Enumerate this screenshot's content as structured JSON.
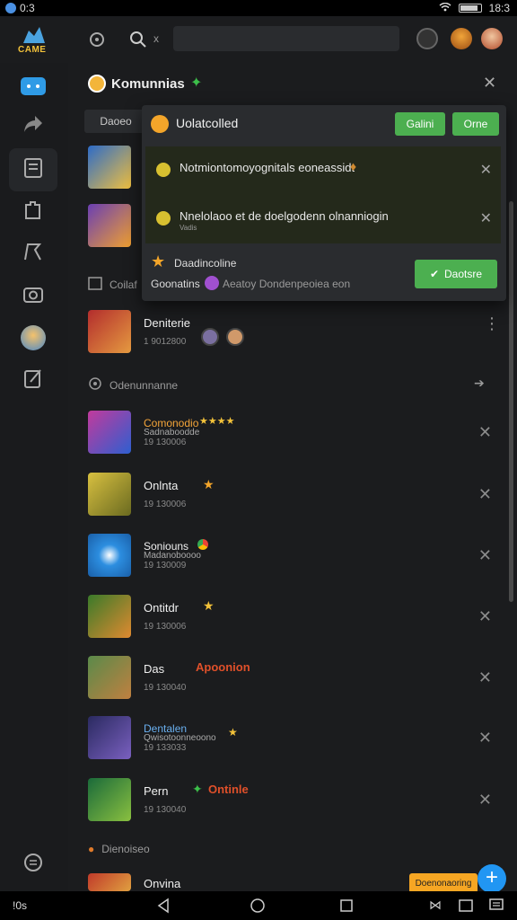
{
  "status": {
    "left_text": "0:3",
    "time": "18:3"
  },
  "topbar": {
    "logo_text": "CAME",
    "search_prefix": "x"
  },
  "panel": {
    "title": "Komunnias",
    "filter_tab": "Daoeo"
  },
  "popup": {
    "title": "Uolatcolled",
    "buttons": [
      "Galini",
      "Orne"
    ],
    "notifications": [
      {
        "text": "Notmiontomoyognitals eoneassidt",
        "sub": ""
      },
      {
        "text": "Nnelolaoo et de doelgodenn  olnanniogin",
        "sub": "Vadis"
      }
    ],
    "footer_title": "Daadincoline",
    "footer_text": "Goonatins",
    "footer_desc": "Aeatoy Dondenpeoiea eon",
    "action_button": "Daotsre"
  },
  "top_rows": [
    {
      "title": "Deniterie",
      "time": "1 9012800"
    }
  ],
  "section1": "Coilaf",
  "section2": "Odenunnanne",
  "list": [
    {
      "title": "Comonodio",
      "sub": "Sadnaboodde",
      "time": "19 130006",
      "stars": "★★★★"
    },
    {
      "title": "Onlnta",
      "sub": "",
      "time": "19 130006",
      "stars": "★"
    },
    {
      "title": "Soniouns",
      "sub": "Madanoboooo",
      "time": "19 130009",
      "stars": ""
    },
    {
      "title": "Ontitdr",
      "sub": "",
      "time": "19 130006",
      "stars": "★"
    },
    {
      "title": "Das",
      "sub": "",
      "time": "19 130040",
      "extra": "Apoonion"
    },
    {
      "title": "Dentalen",
      "sub": "Qwisotoonneoono",
      "time": "19 133033",
      "stars": "★"
    },
    {
      "title": "Pern",
      "sub": "",
      "time": "19 130040",
      "extra": "Ontinle"
    }
  ],
  "section3": "Dienoiseo",
  "bottom_row": {
    "title": "Onvina"
  },
  "bottom_tag": "Doenonaoring",
  "nav": {
    "left_text": "!0s"
  },
  "colors": {
    "accent": "#4caf50",
    "bg": "#1b1c1e",
    "fab": "#2196f3"
  }
}
